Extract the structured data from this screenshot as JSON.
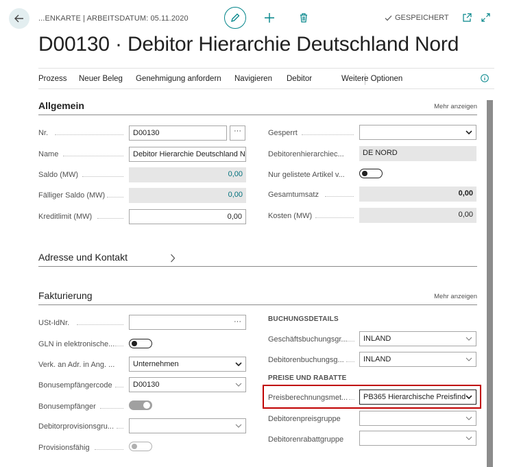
{
  "header": {
    "breadcrumb": "...ENKARTE | ARBEITSDATUM: 05.11.2020",
    "saved_label": "GESPEICHERT",
    "title": "D00130 · Debitor Hierarchie Deutschland Nord"
  },
  "actions": [
    "Prozess",
    "Neuer Beleg",
    "Genehmigung anfordern",
    "Navigieren",
    "Debitor",
    "Weitere Optionen"
  ],
  "allgemein": {
    "title": "Allgemein",
    "more": "Mehr anzeigen",
    "left": [
      {
        "label": "Nr.",
        "value": "D00130"
      },
      {
        "label": "Name",
        "value": "Debitor Hierarchie Deutschland N"
      },
      {
        "label": "Saldo (MW)",
        "value": "0,00"
      },
      {
        "label": "Fälliger Saldo (MW)",
        "value": "0,00"
      },
      {
        "label": "Kreditlimit (MW)",
        "value": "0,00"
      }
    ],
    "right": [
      {
        "label": "Gesperrt",
        "value": ""
      },
      {
        "label": "Debitorenhierarchiec...",
        "value": "DE NORD"
      },
      {
        "label": "Nur gelistete Artikel v...",
        "value": ""
      },
      {
        "label": "Gesamtumsatz",
        "value": "0,00"
      },
      {
        "label": "Kosten (MW)",
        "value": "0,00"
      }
    ]
  },
  "adresse": {
    "title": "Adresse und Kontakt"
  },
  "fakturierung": {
    "title": "Fakturierung",
    "more": "Mehr anzeigen",
    "left": [
      {
        "label": "USt-IdNr.",
        "value": ""
      },
      {
        "label": "GLN in elektronische...",
        "value": ""
      },
      {
        "label": "Verk. an Adr. in Ang. ...",
        "value": "Unternehmen"
      },
      {
        "label": "Bonusempfängercode",
        "value": "D00130"
      },
      {
        "label": "Bonusempfänger",
        "value": ""
      },
      {
        "label": "Debitorprovisionsgru...",
        "value": ""
      },
      {
        "label": "Provisionsfähig",
        "value": ""
      }
    ],
    "buchung_head": "BUCHUNGSDETAILS",
    "buchung": [
      {
        "label": "Geschäftsbuchungsgr...",
        "value": "INLAND"
      },
      {
        "label": "Debitorenbuchungsg...",
        "value": "INLAND"
      }
    ],
    "preise_head": "PREISE UND RABATTE",
    "preise": [
      {
        "label": "Preisberechnungsmet...",
        "value": "PB365 Hierarchische Preisfind"
      },
      {
        "label": "Debitorenpreisgruppe",
        "value": ""
      },
      {
        "label": "Debitorenrabattgruppe",
        "value": ""
      }
    ]
  }
}
